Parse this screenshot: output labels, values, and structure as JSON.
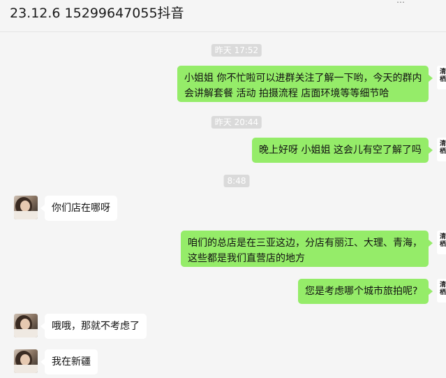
{
  "chat": {
    "title": "23.12.6 15299647055抖音",
    "self_avatar_text": "清\n栖",
    "messages": [
      {
        "type": "time",
        "text": "昨天 17:52"
      },
      {
        "type": "msg",
        "from": "me",
        "lines": [
          "小姐姐 你不忙啦可以进群关注了解一下哟，今天的群内",
          "会讲解套餐 活动  拍摄流程 店面环境等等细节哈"
        ]
      },
      {
        "type": "time",
        "text": "昨天 20:44"
      },
      {
        "type": "msg",
        "from": "me",
        "lines": [
          "晚上好呀 小姐姐 这会儿有空了解了吗"
        ]
      },
      {
        "type": "time",
        "text": "8:48"
      },
      {
        "type": "msg",
        "from": "other",
        "lines": [
          "你们店在哪呀"
        ]
      },
      {
        "type": "msg",
        "from": "me",
        "lines": [
          "咱们的总店是在三亚这边，分店有丽江、大理、青海，",
          "这些都是我们直营店的地方"
        ]
      },
      {
        "type": "msg",
        "from": "me",
        "lines": [
          "您是考虑哪个城市旅拍呢?"
        ]
      },
      {
        "type": "msg",
        "from": "other",
        "lines": [
          "哦哦，那就不考虑了"
        ]
      },
      {
        "type": "msg",
        "from": "other",
        "lines": [
          "我在新疆"
        ]
      }
    ]
  },
  "colors": {
    "my_bubble": "#95ec69",
    "their_bubble": "#ffffff",
    "background": "#f5f5f5",
    "timestamp_bg": "#dadada"
  }
}
